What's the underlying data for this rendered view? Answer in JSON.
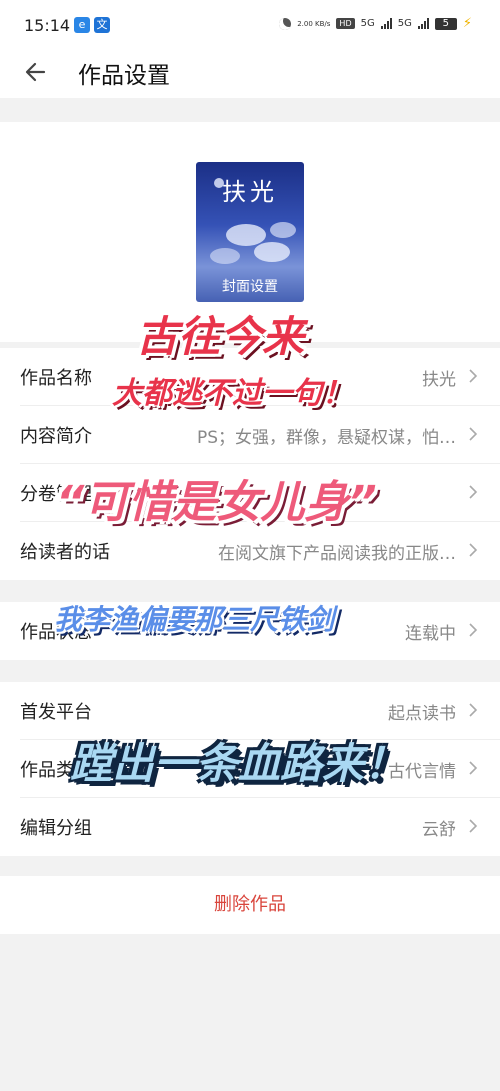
{
  "status_bar": {
    "time": "15:14",
    "speed": "2.00\nKB/s",
    "hd": "HD",
    "net1": "5G",
    "net2": "5G",
    "battery": "5"
  },
  "header": {
    "title": "作品设置"
  },
  "cover": {
    "book_title": "扶光",
    "label": "封面设置"
  },
  "group1": [
    {
      "label": "作品名称",
      "value": "扶光"
    },
    {
      "label": "内容简介",
      "value": "PS；女强，群像，悬疑权谋，怕…"
    },
    {
      "label": "分卷管理",
      "value": ""
    },
    {
      "label": "给读者的话",
      "value": "在阅文旗下产品阅读我的正版…"
    }
  ],
  "group2": [
    {
      "label": "作品状态",
      "value": "连载中"
    }
  ],
  "group3": [
    {
      "label": "首发平台",
      "value": "起点读书"
    },
    {
      "label": "作品类型",
      "value": "古代言情"
    },
    {
      "label": "编辑分组",
      "value": "云舒"
    }
  ],
  "delete_label": "删除作品",
  "overlay": {
    "line1": "古往今来",
    "line2": "大都逃不过一句！",
    "line3": "“可惜是女儿身”",
    "line4": "我李渔偏要那三尺铁剑",
    "line5": "蹚出一条血路来！"
  },
  "colors": {
    "accent_red": "#d9453c",
    "cover_blue": "#2b45a5"
  }
}
